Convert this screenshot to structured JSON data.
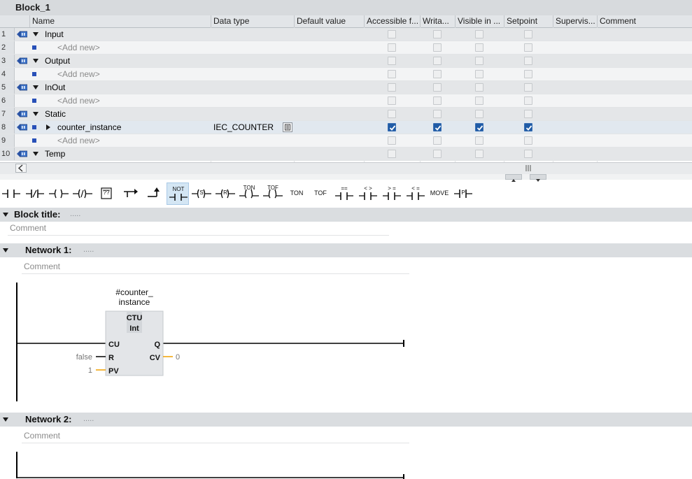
{
  "block": {
    "title": "Block_1"
  },
  "table": {
    "columns": [
      "Name",
      "Data type",
      "Default value",
      "Accessible f...",
      "Writa...",
      "Visible in ...",
      "Setpoint",
      "Supervis...",
      "Comment"
    ],
    "rows": [
      {
        "num": "1",
        "kind": "section",
        "name": "Input"
      },
      {
        "num": "2",
        "kind": "add",
        "name": "<Add new>"
      },
      {
        "num": "3",
        "kind": "section",
        "name": "Output"
      },
      {
        "num": "4",
        "kind": "add",
        "name": "<Add new>"
      },
      {
        "num": "5",
        "kind": "section",
        "name": "InOut"
      },
      {
        "num": "6",
        "kind": "add",
        "name": "<Add new>"
      },
      {
        "num": "7",
        "kind": "section",
        "name": "Static"
      },
      {
        "num": "8",
        "kind": "var",
        "name": "counter_instance",
        "datatype": "IEC_COUNTER",
        "checks": [
          true,
          true,
          true,
          true
        ]
      },
      {
        "num": "9",
        "kind": "add",
        "name": "<Add new>"
      },
      {
        "num": "10",
        "kind": "section",
        "name": "Temp"
      }
    ]
  },
  "toolbar": {
    "items": [
      {
        "id": "no-contact",
        "label": ""
      },
      {
        "id": "nc-contact",
        "label": ""
      },
      {
        "id": "coil",
        "label": ""
      },
      {
        "id": "negated-coil",
        "label": ""
      },
      {
        "id": "empty-box",
        "label": "??"
      },
      {
        "id": "open-branch",
        "label": ""
      },
      {
        "id": "close-branch",
        "label": ""
      },
      {
        "id": "not",
        "label": "NOT"
      },
      {
        "id": "set-coil",
        "label": "S"
      },
      {
        "id": "reset-coil",
        "label": "R"
      },
      {
        "id": "ton-coil",
        "label": "TON"
      },
      {
        "id": "tof-coil",
        "label": "TOF"
      },
      {
        "id": "ton-box",
        "label": "TON"
      },
      {
        "id": "tof-box",
        "label": "TOF"
      },
      {
        "id": "cmp-eq",
        "label": "=="
      },
      {
        "id": "cmp-ne",
        "label": "< >"
      },
      {
        "id": "cmp-ge",
        "label": "> ="
      },
      {
        "id": "cmp-le",
        "label": "< ="
      },
      {
        "id": "move",
        "label": "MOVE"
      },
      {
        "id": "p-contact",
        "label": "P"
      }
    ]
  },
  "editor": {
    "block_title_label": "Block title:",
    "block_comment": "Comment",
    "title_dots": ".....",
    "networks": [
      {
        "label": "Network 1:",
        "comment": "Comment",
        "instance_line1": "#counter_",
        "instance_line2": "instance",
        "fb_name": "CTU",
        "fb_type": "Int",
        "in_cu": "CU",
        "in_r": "R",
        "in_pv": "PV",
        "out_q": "Q",
        "out_cv": "CV",
        "val_r": "false",
        "val_pv": "1",
        "val_cv": "0"
      },
      {
        "label": "Network 2:",
        "comment": "Comment"
      }
    ]
  },
  "colors": {
    "selected_row": "#e1e8ef",
    "checkbox_on": "#1f5ba6",
    "bool_wire": "#000000",
    "int_wire": "#f0a000",
    "toolbar_selected": "#d4e6f4"
  }
}
